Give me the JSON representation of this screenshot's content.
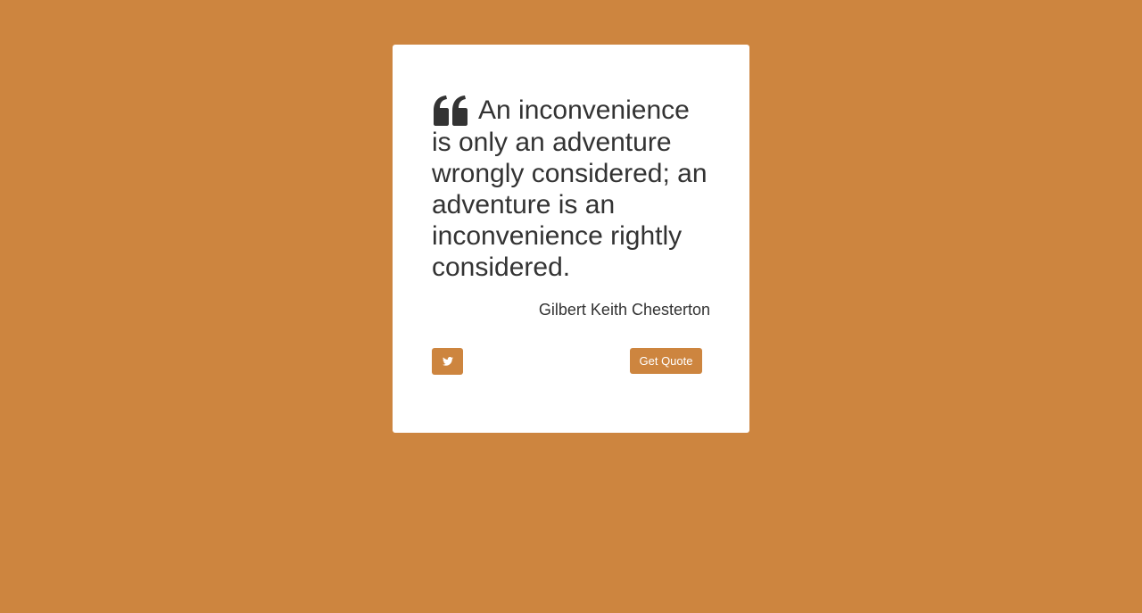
{
  "quote": {
    "text": "An inconvenience is only an adventure wrongly considered; an adventure is an inconvenience rightly considered.",
    "author": "Gilbert Keith Chesterton",
    "icon": "quote-left-icon"
  },
  "actions": {
    "tweet_icon": "twitter-icon",
    "new_quote_label": "Get Quote"
  },
  "colors": {
    "background": "#cd853f",
    "card": "#ffffff",
    "text": "#333333",
    "button": "#cd853f",
    "button_text": "#ffffff"
  }
}
